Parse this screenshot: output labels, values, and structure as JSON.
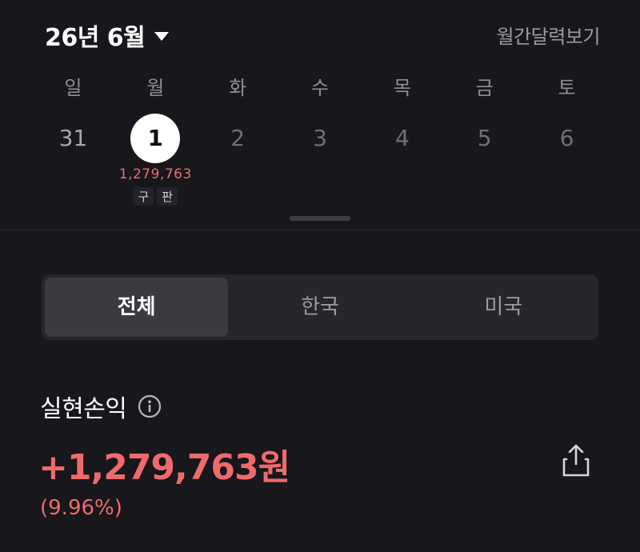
{
  "header": {
    "month_label": "26년 6월",
    "monthly_calendar_link": "월간달력보기"
  },
  "week": {
    "day_names": [
      "일",
      "월",
      "화",
      "수",
      "목",
      "금",
      "토"
    ],
    "days": [
      {
        "num": "31",
        "state": "prev"
      },
      {
        "num": "1",
        "state": "selected",
        "profit": "1,279,763",
        "tags": [
          "구",
          "판"
        ]
      },
      {
        "num": "2",
        "state": "future"
      },
      {
        "num": "3",
        "state": "future"
      },
      {
        "num": "4",
        "state": "future"
      },
      {
        "num": "5",
        "state": "future"
      },
      {
        "num": "6",
        "state": "future"
      }
    ]
  },
  "segment": {
    "items": [
      "전체",
      "한국",
      "미국"
    ],
    "active": "전체"
  },
  "realized_profit": {
    "title": "실현손익",
    "amount": "+1,279,763원",
    "rate": "(9.96%)"
  },
  "icons": {
    "caret": "caret-down-icon",
    "info": "info-icon",
    "share": "share-icon"
  },
  "colors": {
    "background": "#17171c",
    "profit_red": "#ef6b6b",
    "segment_bg": "#26262c",
    "segment_active": "#3a3a41"
  }
}
